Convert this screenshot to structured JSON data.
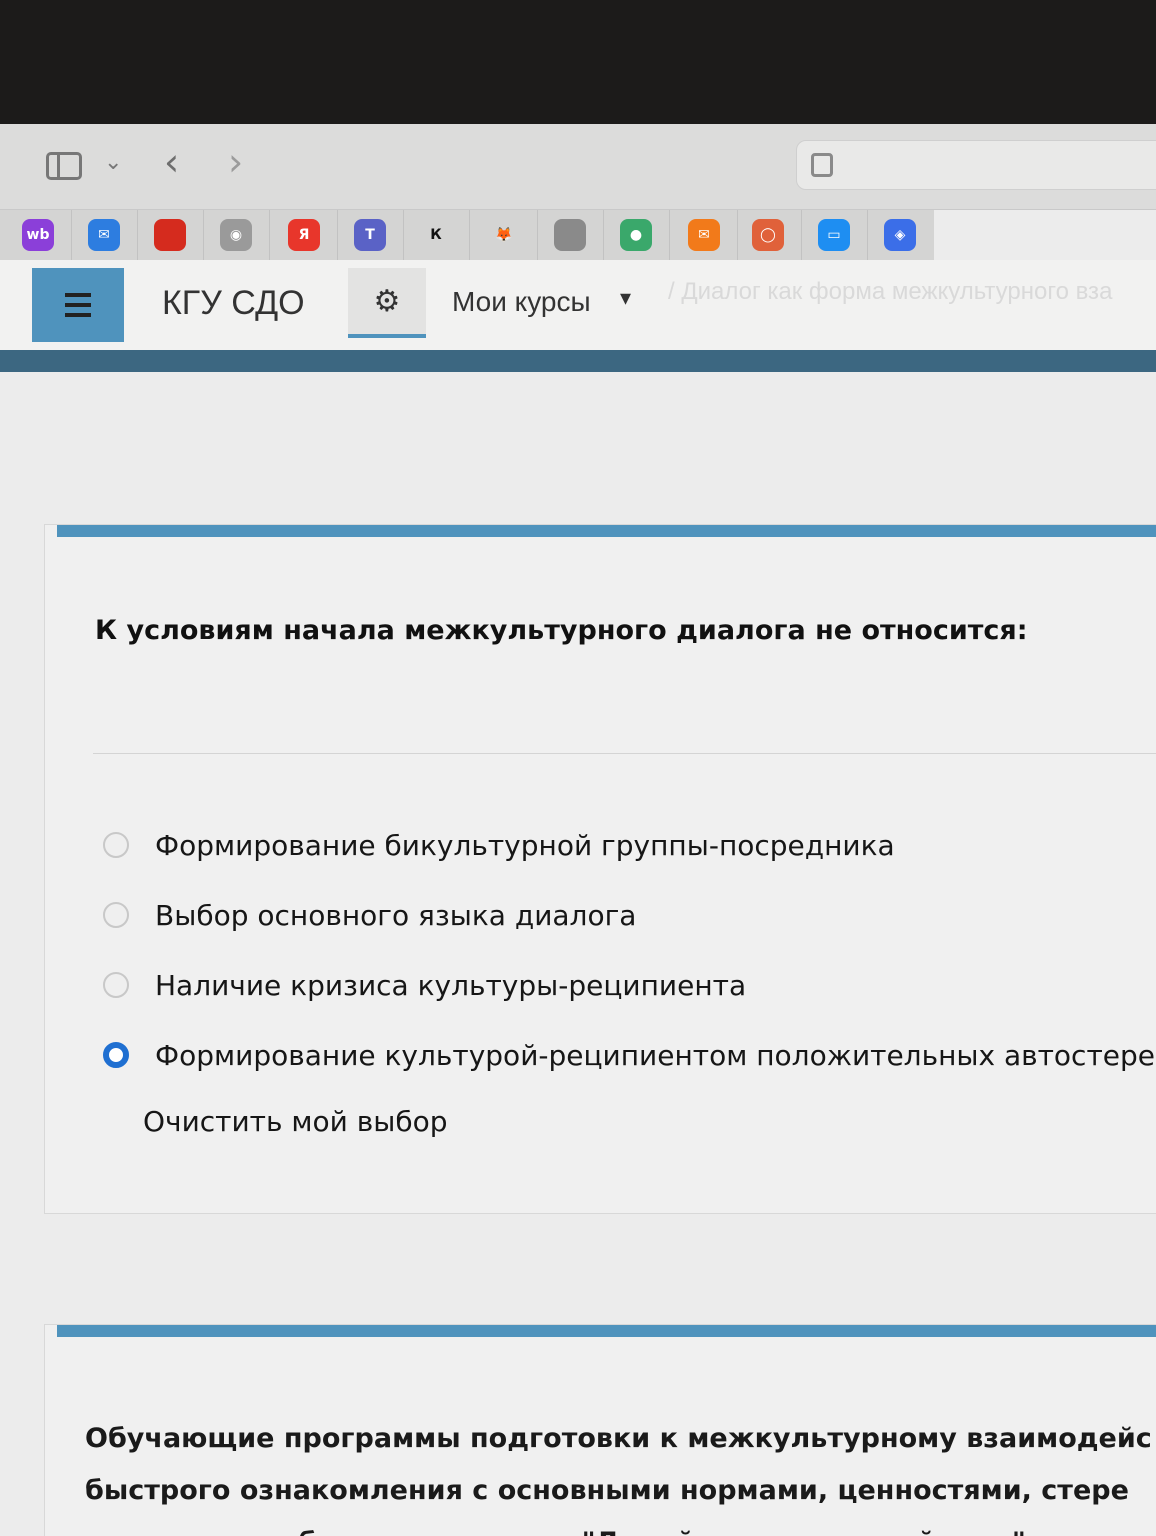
{
  "browser": {
    "icons": [
      "sidebar-icon",
      "chevron-down-icon",
      "back-icon",
      "forward-icon",
      "reader-icon"
    ],
    "nav": {
      "back": "‹",
      "forward": "›"
    }
  },
  "favorites": [
    {
      "name": "wb",
      "label": "wb",
      "color": "#8b3fd9"
    },
    {
      "name": "mail",
      "label": "✉",
      "color": "#2d7de0"
    },
    {
      "name": "flag-ru",
      "label": "",
      "color": "#d52b1e"
    },
    {
      "name": "emblem",
      "label": "◉",
      "color": "#9a9a9a"
    },
    {
      "name": "yandex",
      "label": "Я",
      "color": "#e8362b"
    },
    {
      "name": "teams",
      "label": "T",
      "color": "#5a62c6"
    },
    {
      "name": "kinopoisk",
      "label": "К",
      "color": "#d4d4d3"
    },
    {
      "name": "fox",
      "label": "🦊",
      "color": "#d4d4d3"
    },
    {
      "name": "apple",
      "label": "",
      "color": "#8a8a8a"
    },
    {
      "name": "dots",
      "label": "●",
      "color": "#3aa86b"
    },
    {
      "name": "mailru",
      "label": "✉",
      "color": "#f27a1a"
    },
    {
      "name": "circle",
      "label": "◯",
      "color": "#e0613a"
    },
    {
      "name": "chat",
      "label": "▭",
      "color": "#1e8ef2"
    },
    {
      "name": "compass",
      "label": "◈",
      "color": "#3b6ee8"
    }
  ],
  "site": {
    "title": "КГУ СДО",
    "my_courses": "Мои курсы",
    "faint_breadcrumb": "/ Диалог как форма межкультурного вза"
  },
  "quiz": {
    "question": "К условиям начала межкультурного диалога не относится:",
    "options": [
      {
        "label": "Формирование бикультурной группы-посредника",
        "checked": false
      },
      {
        "label": "Выбор основного языка диалога",
        "checked": false
      },
      {
        "label": "Наличие кризиса культуры-реципиента",
        "checked": false
      },
      {
        "label": "Формирование культурой-реципиентом положительных автостерео",
        "checked": true
      }
    ],
    "clear_choice": "Очистить мой выбор"
  },
  "question2": {
    "lines": [
      "Обучающие программы подготовки к межкультурному взаимодейс",
      "быстрого ознакомления с основными нормами, ценностями, стере",
      "помощью особых правил типа: \"Делай это и не делай того\", эт"
    ]
  }
}
